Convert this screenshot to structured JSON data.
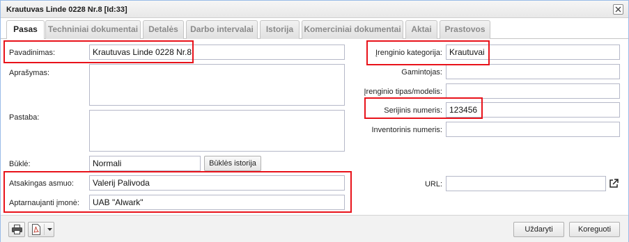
{
  "window": {
    "title": "Krautuvas Linde 0228 Nr.8 [Id:33]"
  },
  "tabs": [
    {
      "label": "Pasas",
      "active": true
    },
    {
      "label": "Techniniai dokumentai"
    },
    {
      "label": "Detalės"
    },
    {
      "label": "Darbo intervalai"
    },
    {
      "label": "Istorija"
    },
    {
      "label": "Komerciniai dokumentai"
    },
    {
      "label": "Aktai"
    },
    {
      "label": "Prastovos"
    }
  ],
  "form": {
    "name_label": "Pavadinimas:",
    "name_value": "Krautuvas Linde 0228 Nr.8",
    "description_label": "Aprašymas:",
    "note_label": "Pastaba:",
    "state_label": "Būklė:",
    "state_value": "Normali",
    "state_history_button": "Būklės istorija",
    "responsible_label": "Atsakingas asmuo:",
    "responsible_value": "Valerij Palivoda",
    "service_company_label": "Aptarnaujanti įmonė:",
    "service_company_value": "UAB \"Alwark\"",
    "category_label": "Įrenginio kategorija:",
    "category_value": "Krautuvai",
    "manufacturer_label": "Gamintojas:",
    "manufacturer_value": "",
    "model_label": "Įrenginio tipas/modelis:",
    "model_value": "",
    "serial_label": "Serijinis numeris:",
    "serial_value": "123456",
    "inventory_label": "Inventorinis numeris:",
    "inventory_value": "",
    "url_label": "URL:",
    "url_value": ""
  },
  "footer": {
    "close_button": "Uždaryti",
    "edit_button": "Koreguoti"
  },
  "icons": [
    "close-icon",
    "external-link-icon",
    "printer-icon",
    "pdf-icon",
    "dropdown-arrow-icon"
  ],
  "highlight_color": "#e8121a"
}
